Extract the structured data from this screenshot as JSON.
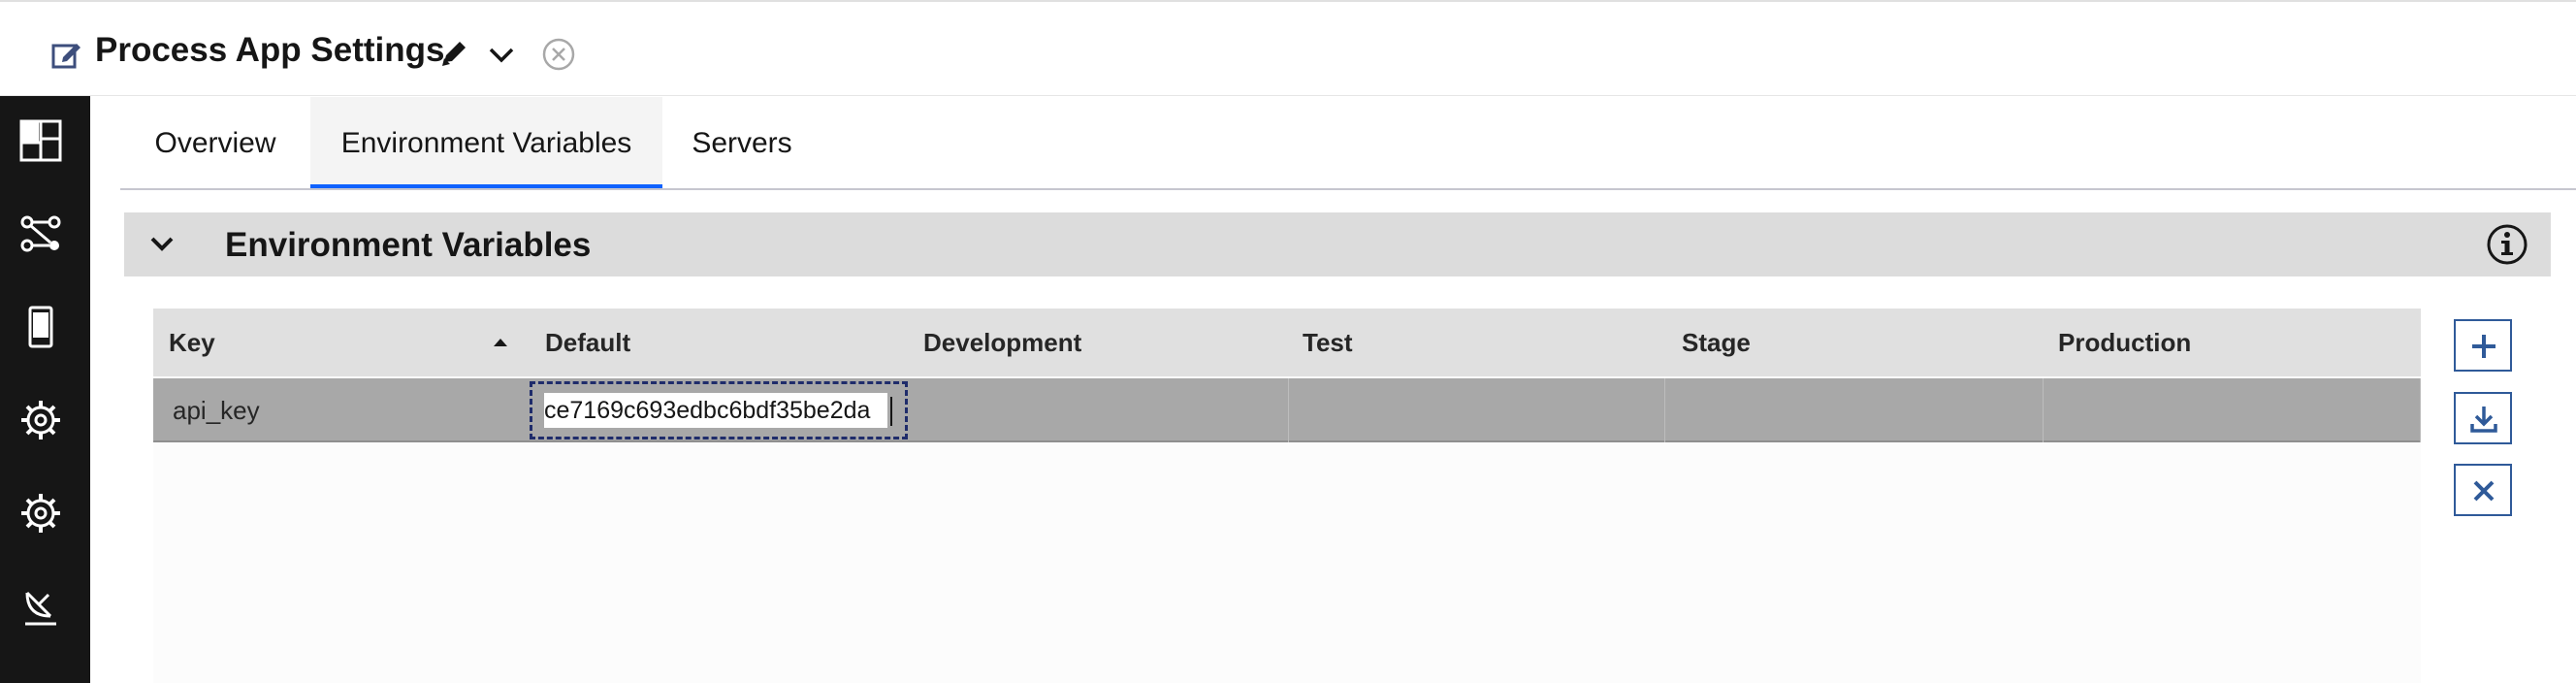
{
  "header": {
    "title": "Process App Settings",
    "icons": [
      "process-app-icon",
      "pencil-icon",
      "chevron-down-icon",
      "close-circle-icon"
    ]
  },
  "sidebar": {
    "items": [
      {
        "icon": "dashboard-grid-icon"
      },
      {
        "icon": "flow-nodes-icon"
      },
      {
        "icon": "mobile-device-icon"
      },
      {
        "icon": "gear-badge-icon"
      },
      {
        "icon": "gear-icon"
      },
      {
        "icon": "satellite-dish-icon"
      }
    ]
  },
  "tabs": [
    {
      "label": "Overview",
      "selected": false
    },
    {
      "label": "Environment Variables",
      "selected": true
    },
    {
      "label": "Servers",
      "selected": false
    }
  ],
  "section": {
    "title": "Environment Variables",
    "expanded": true
  },
  "table": {
    "columns": [
      "Key",
      "Default",
      "Development",
      "Test",
      "Stage",
      "Production"
    ],
    "sorted_column": "Key",
    "sort_direction": "ascending",
    "rows": [
      {
        "key": "api_key",
        "default": "ce7169c693edbc6bdf35be2da",
        "development": "",
        "test": "",
        "stage": "",
        "production": ""
      }
    ]
  },
  "actions": [
    {
      "icon": "add-icon"
    },
    {
      "icon": "download-icon"
    },
    {
      "icon": "delete-icon"
    }
  ],
  "colors": {
    "accent": "#0f62fe",
    "sidebar_bg": "#161616",
    "row_selected": "#a8a8a8",
    "action_border": "#2f5a99"
  }
}
